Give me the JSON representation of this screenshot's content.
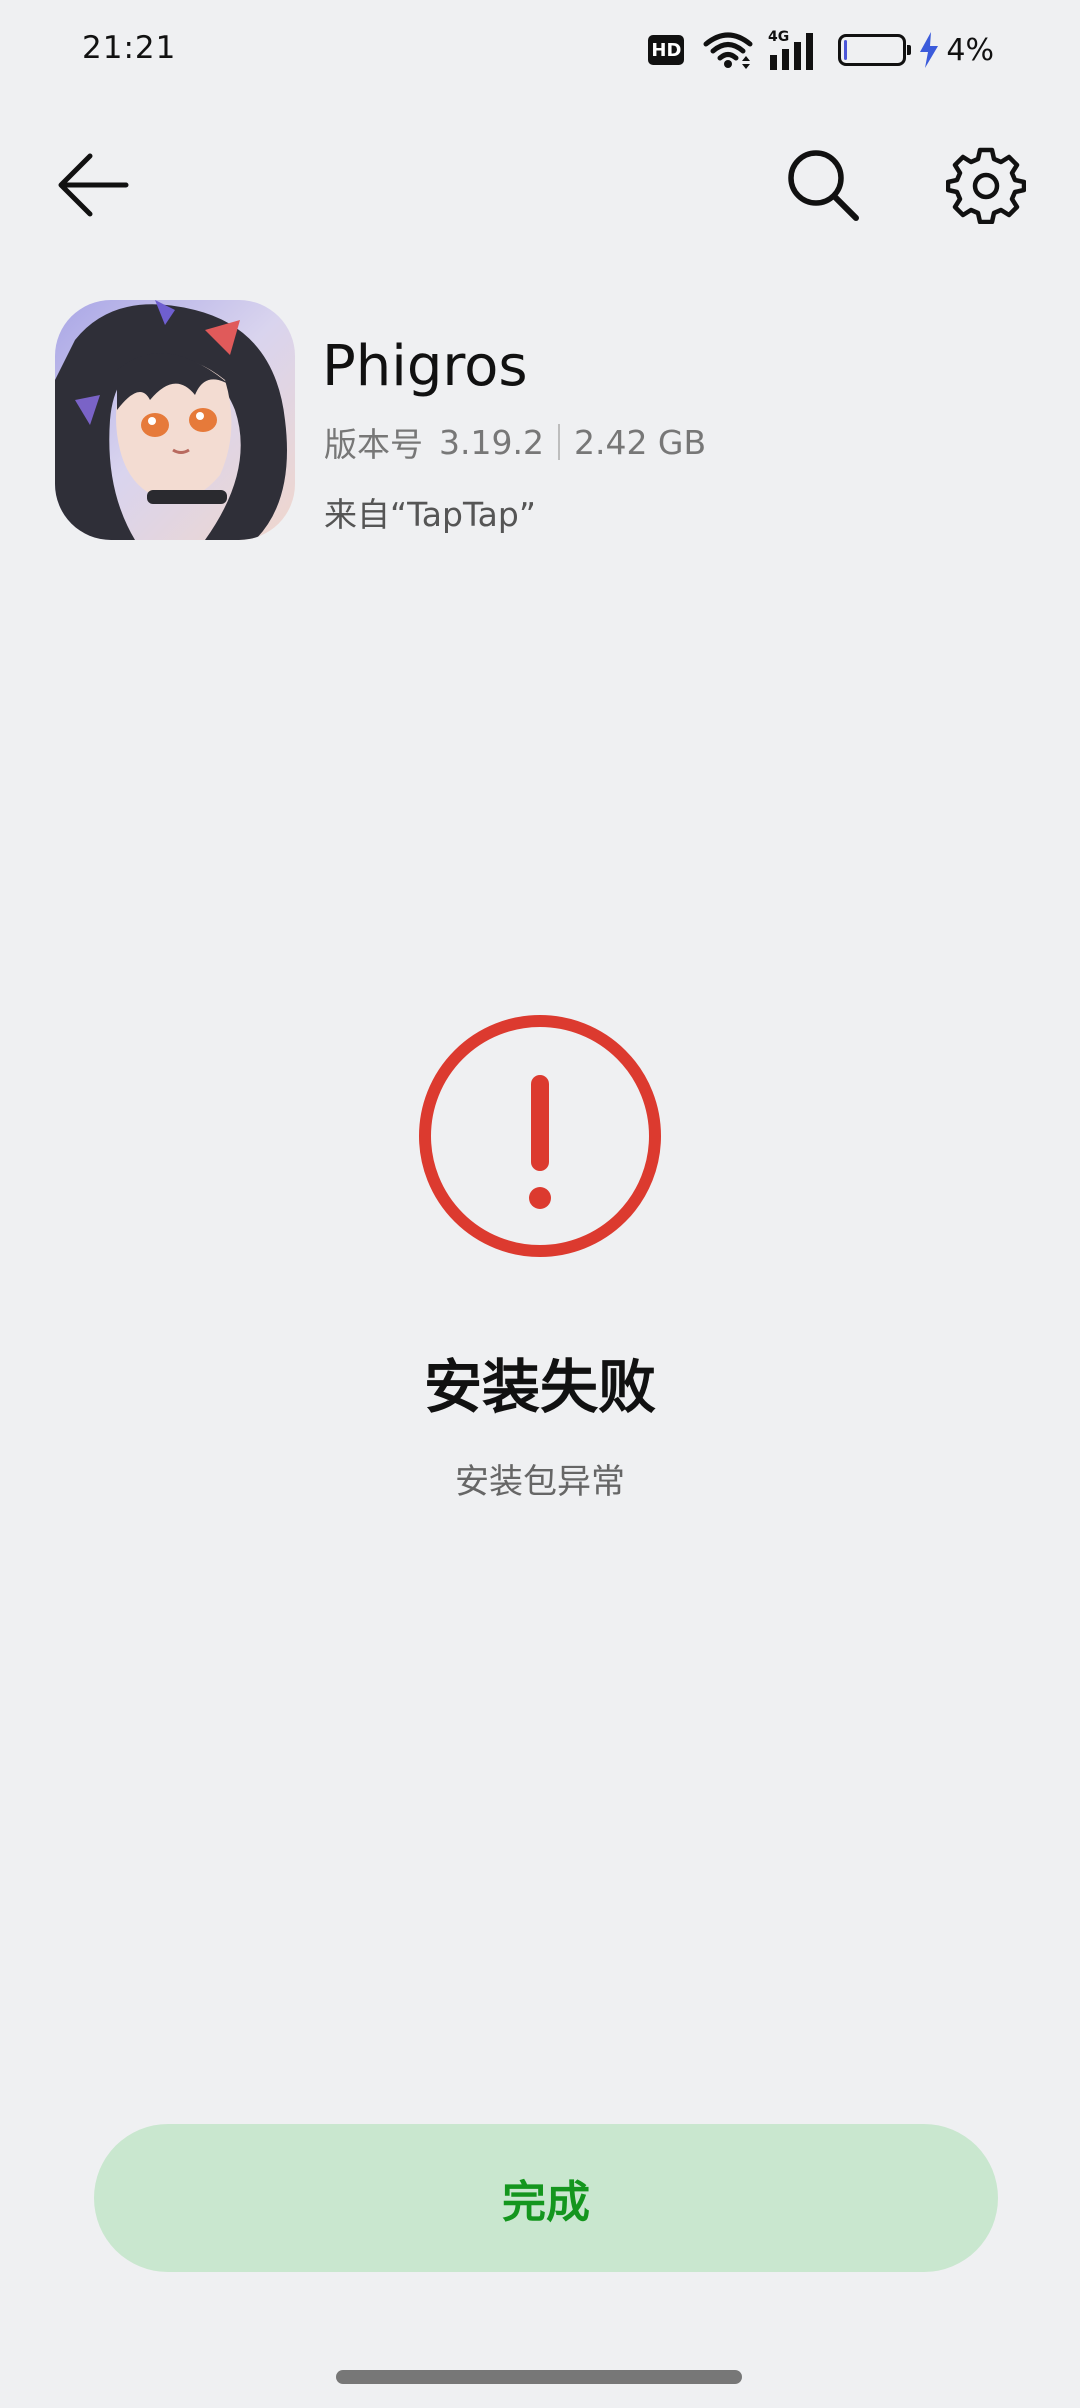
{
  "status_bar": {
    "time": "21:21",
    "hd_label": "HD",
    "network_label": "4G",
    "battery_percent": "4%",
    "battery_level": 0.04,
    "battery_fill_color": "#4b56d8",
    "charging_color": "#3b5bdb"
  },
  "app_bar": {
    "back_icon": "arrow-left",
    "search_icon": "magnifier",
    "settings_icon": "gear"
  },
  "app": {
    "name": "Phigros",
    "version_label": "版本号",
    "version": "3.19.2",
    "size": "2.42 GB",
    "source": "来自“TapTap”"
  },
  "result": {
    "status_icon": "exclamation-circle",
    "status_color": "#dc3a2f",
    "title": "安装失败",
    "subtitle": "安装包异常"
  },
  "actions": {
    "done_label": "完成",
    "done_text_color": "#14961e",
    "done_background": "#c9e7cf"
  }
}
